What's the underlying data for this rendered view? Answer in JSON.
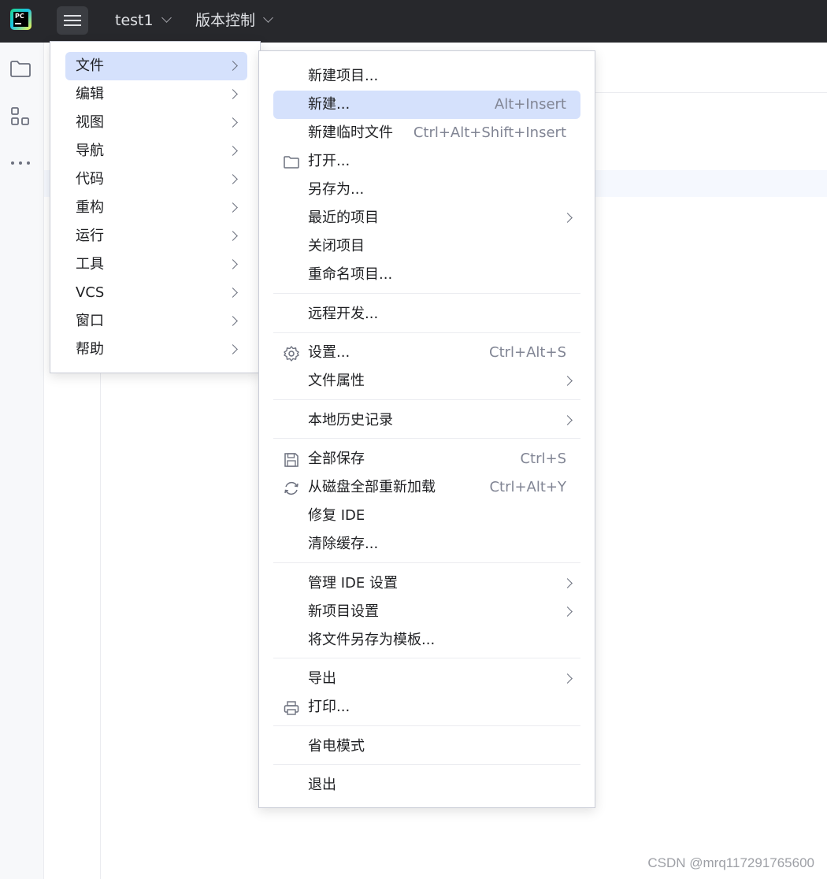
{
  "titlebar": {
    "logo_text": "PC",
    "project": "test1",
    "vcs": "版本控制"
  },
  "main_menu": {
    "items": [
      {
        "label": "文件",
        "selected": true
      },
      {
        "label": "编辑"
      },
      {
        "label": "视图"
      },
      {
        "label": "导航"
      },
      {
        "label": "代码"
      },
      {
        "label": "重构"
      },
      {
        "label": "运行"
      },
      {
        "label": "工具"
      },
      {
        "label": "VCS"
      },
      {
        "label": "窗口"
      },
      {
        "label": "帮助"
      }
    ]
  },
  "file_menu": {
    "new_project": "新建项目...",
    "new": "新建...",
    "new_shortcut": "Alt+Insert",
    "new_scratch": "新建临时文件",
    "new_scratch_shortcut": "Ctrl+Alt+Shift+Insert",
    "open": "打开...",
    "save_as": "另存为...",
    "recent": "最近的项目",
    "close_project": "关闭项目",
    "rename_project": "重命名项目...",
    "remote_dev": "远程开发...",
    "settings": "设置...",
    "settings_shortcut": "Ctrl+Alt+S",
    "file_props": "文件属性",
    "local_history": "本地历史记录",
    "save_all": "全部保存",
    "save_all_shortcut": "Ctrl+S",
    "reload": "从磁盘全部重新加载",
    "reload_shortcut": "Ctrl+Alt+Y",
    "repair_ide": "修复 IDE",
    "invalidate": "清除缓存...",
    "manage_ide": "管理 IDE 设置",
    "new_proj_settings": "新项目设置",
    "save_template": "将文件另存为模板...",
    "export": "导出",
    "print": "打印...",
    "power_save": "省电模式",
    "exit": "退出"
  },
  "watermark": "CSDN @mrq117291765600"
}
